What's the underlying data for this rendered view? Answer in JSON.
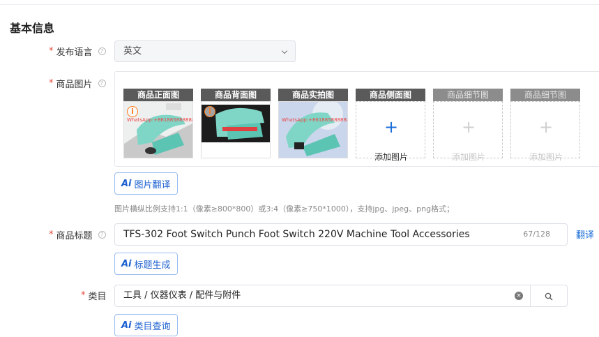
{
  "section": {
    "title": "基本信息"
  },
  "language": {
    "label": "发布语言",
    "value": "英文"
  },
  "images": {
    "label": "商品图片",
    "slots": [
      {
        "caption": "商品正面图",
        "filled": true,
        "watermark": "WhatsApp:+8618858888888"
      },
      {
        "caption": "商品背面图",
        "filled": true
      },
      {
        "caption": "商品实拍图",
        "filled": true,
        "watermark": "WhatsApp:+8618858888888"
      },
      {
        "caption": "商品侧面图",
        "filled": false,
        "add_label": "添加图片",
        "active": true
      },
      {
        "caption": "商品细节图",
        "filled": false,
        "add_label": "添加图片",
        "active": false
      },
      {
        "caption": "商品细节图",
        "filled": false,
        "add_label": "添加图片",
        "active": false
      }
    ],
    "translate_button": "图片翻译",
    "hint": "图片横纵比例支持1:1（像素≥800*800）或3:4（像素≥750*1000），支持jpg、jpeg、png格式；"
  },
  "product_title": {
    "label": "商品标题",
    "value": "TFS-302 Foot Switch Punch Foot Switch 220V Machine Tool Accessories",
    "counter": "67/128",
    "translate_link": "翻译",
    "generate_button": "标题生成"
  },
  "category": {
    "label": "类目",
    "value": "工具 / 仪器仪表 / 配件与附件",
    "query_button": "类目查询"
  },
  "ai_label": "Ai",
  "colors": {
    "accent": "#1a6ed8",
    "required": "#e84a3c",
    "product_teal": "#7fd6c6"
  }
}
